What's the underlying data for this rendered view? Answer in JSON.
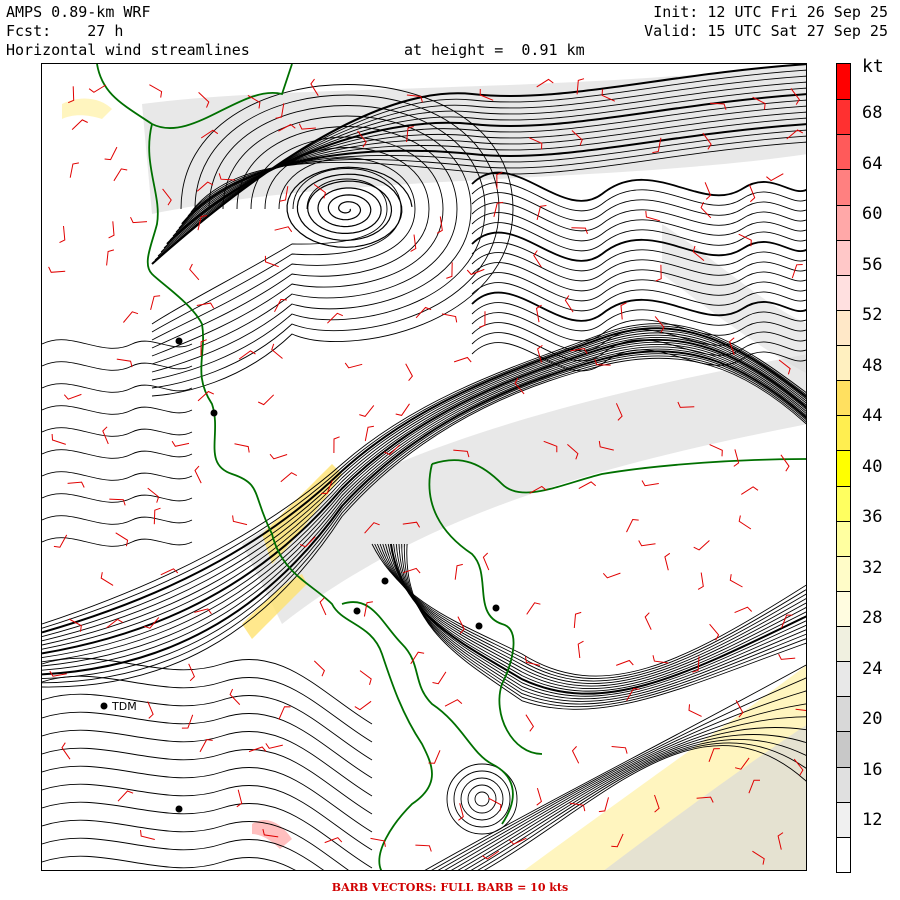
{
  "header": {
    "model": "AMPS 0.89-km WRF",
    "forecast": "Fcst:    27 h",
    "field": "Horizontal wind streamlines",
    "height": "at height =  0.91 km",
    "init": "Init: 12 UTC Fri 26 Sep 25",
    "valid": "Valid: 15 UTC Sat 27 Sep 25"
  },
  "colorbar": {
    "unit": "kt",
    "labels": [
      "68",
      "64",
      "60",
      "56",
      "52",
      "48",
      "44",
      "40",
      "36",
      "32",
      "28",
      "24",
      "20",
      "16",
      "12"
    ],
    "colors": [
      "#ff0000",
      "#ff3030",
      "#ff5a5a",
      "#ff8080",
      "#ffa8a8",
      "#ffc8c8",
      "#ffe0e0",
      "#ffe8c8",
      "#fff0c0",
      "#ffe060",
      "#ffee50",
      "#ffff00",
      "#ffff60",
      "#ffffa0",
      "#fffcc8",
      "#fffce0",
      "#f0f0e0",
      "#e8e8e8",
      "#d8d8d8",
      "#c8c8c8",
      "#e0e0e0",
      "#f0f0f0",
      "#ffffff"
    ]
  },
  "map": {
    "stations": [
      {
        "label": ""
      },
      {
        "label": ""
      },
      {
        "label": ""
      },
      {
        "label": ""
      },
      {
        "label": ""
      },
      {
        "label": ""
      },
      {
        "label": "TDM"
      },
      {
        "label": ""
      }
    ],
    "colors": {
      "streamline": "#000000",
      "barb": "#e00000",
      "coast": "#007000",
      "shade": "#cfcfcf",
      "shade_yellow": "#fff3b0"
    }
  },
  "footer": "BARB VECTORS:  FULL BARB = 10 kts"
}
